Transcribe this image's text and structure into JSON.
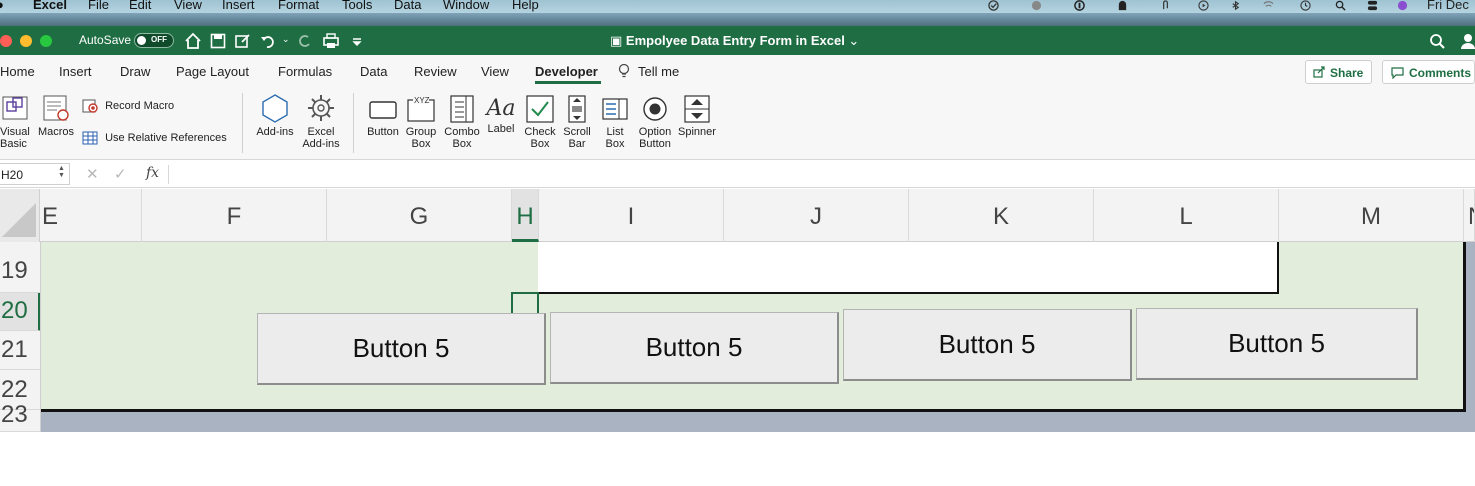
{
  "menubar": {
    "app": "Excel",
    "items": [
      "File",
      "Edit",
      "View",
      "Insert",
      "Format",
      "Tools",
      "Data",
      "Window",
      "Help"
    ],
    "clock": "Fri Dec"
  },
  "titlebar": {
    "autosave_label": "AutoSave",
    "autosave_state": "OFF",
    "document_title": "Empolyee Data Entry Form in Excel"
  },
  "ribbon_tabs": {
    "items": [
      "Home",
      "Insert",
      "Draw",
      "Page Layout",
      "Formulas",
      "Data",
      "Review",
      "View",
      "Developer",
      "Tell me"
    ],
    "active": "Developer",
    "share_label": "Share",
    "comments_label": "Comments"
  },
  "ribbon": {
    "visual_basic": "Visual Basic",
    "macros": "Macros",
    "record_macro": "Record Macro",
    "relative_refs": "Use Relative References",
    "add_ins": "Add-ins",
    "excel_add_ins": "Excel Add-ins",
    "controls": {
      "button": "Button",
      "group_box": "Group Box",
      "combo_box": "Combo Box",
      "label": "Label",
      "check_box": "Check Box",
      "scroll_bar": "Scroll Bar",
      "list_box": "List Box",
      "option_button": "Option Button",
      "spinner": "Spinner"
    }
  },
  "formula_bar": {
    "name_box": "H20",
    "fx_label": "fx",
    "cancel_symbol": "✕",
    "enter_symbol": "✓",
    "formula": ""
  },
  "grid": {
    "columns": [
      "E",
      "F",
      "G",
      "H",
      "I",
      "J",
      "K",
      "L",
      "M",
      "N"
    ],
    "rows": [
      "19",
      "20",
      "21",
      "22",
      "23"
    ],
    "selected_column": "H",
    "selected_row": "20"
  },
  "form_buttons": [
    "Button 5",
    "Button 5",
    "Button 5",
    "Button 5"
  ],
  "colors": {
    "excel_green": "#1f6e43",
    "sheet_fill": "#e2eddb"
  }
}
